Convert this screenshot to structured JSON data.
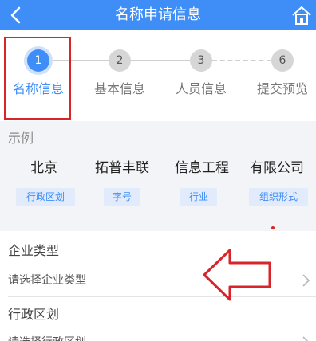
{
  "header": {
    "title": "名称申请信息",
    "back_icon": "chevron-left-icon",
    "home_icon": "home-icon",
    "background": "#3f8ef7"
  },
  "steps": [
    {
      "number": "1",
      "label": "名称信息",
      "active": true
    },
    {
      "number": "2",
      "label": "基本信息",
      "active": false
    },
    {
      "number": "3",
      "label": "人员信息",
      "active": false
    },
    {
      "number": "6",
      "label": "提交预览",
      "active": false
    }
  ],
  "example": {
    "title": "示例",
    "items": [
      {
        "name": "北京",
        "tag": "行政区划"
      },
      {
        "name": "拓普丰联",
        "tag": "字号"
      },
      {
        "name": "信息工程",
        "tag": "行业"
      },
      {
        "name": "有限公司",
        "tag": "组织形式"
      }
    ]
  },
  "form": {
    "fields": [
      {
        "label": "企业类型",
        "placeholder": "请选择企业类型"
      },
      {
        "label": "行政区划",
        "placeholder": "请选择行政区划"
      }
    ]
  },
  "annotation": {
    "highlight_color": "#d7252a"
  }
}
